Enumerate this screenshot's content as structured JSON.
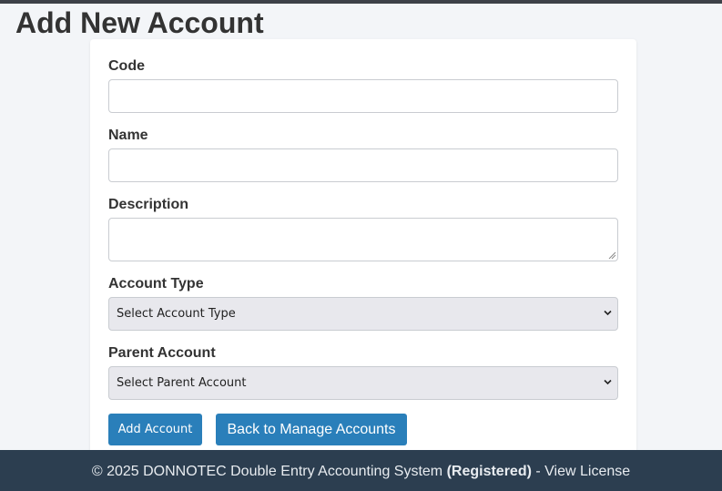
{
  "page": {
    "title": "Add New Account"
  },
  "form": {
    "code": {
      "label": "Code",
      "value": "",
      "placeholder": ""
    },
    "name": {
      "label": "Name",
      "value": "",
      "placeholder": ""
    },
    "description": {
      "label": "Description",
      "value": "",
      "placeholder": ""
    },
    "account_type": {
      "label": "Account Type",
      "selected": "Select Account Type"
    },
    "parent_account": {
      "label": "Parent Account",
      "selected": "Select Parent Account"
    },
    "buttons": {
      "add_label": "Add Account",
      "back_label": "Back to Manage Accounts"
    }
  },
  "footer": {
    "copyright": "© 2025 DONNOTEC Double Entry Accounting System",
    "status": "(Registered)",
    "separator": "-",
    "license_link": "View License"
  },
  "colors": {
    "primary_button": "#2a7fba",
    "footer_background": "#2c3e50",
    "page_background": "#f3f5f8",
    "select_background": "#e8e8ed"
  },
  "icons": {
    "select_arrow": "chevron-down-icon",
    "textarea_grip": "resize-grip-icon"
  }
}
